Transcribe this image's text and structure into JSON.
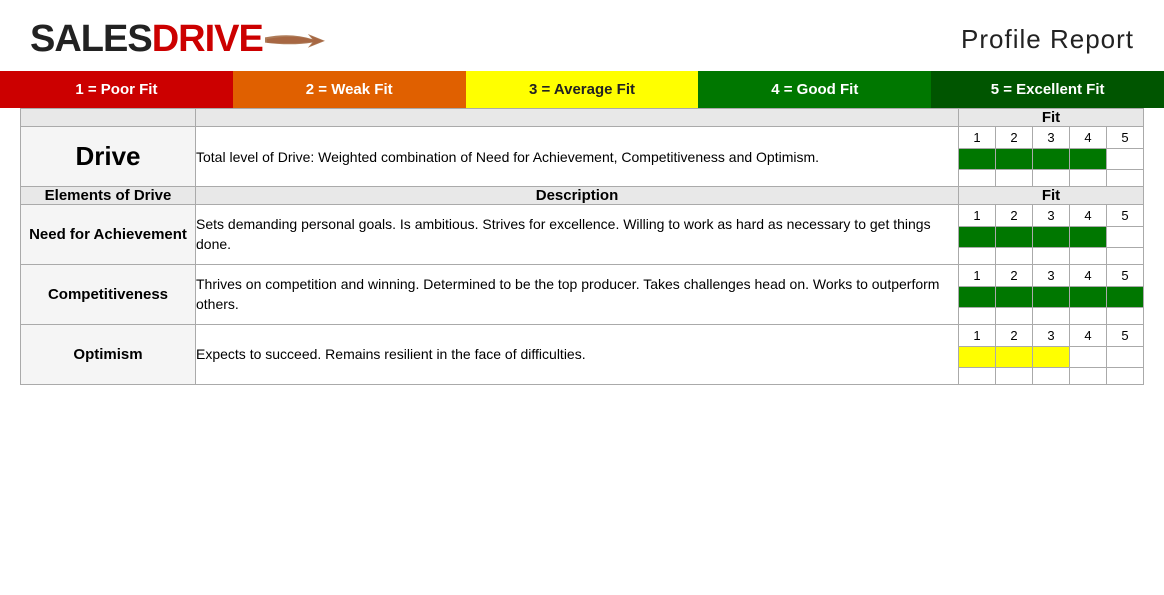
{
  "header": {
    "logo_sales": "SALES",
    "logo_drive": "DRIVE",
    "report_title": "Profile  Report"
  },
  "legend": [
    {
      "label": "1 = Poor Fit",
      "class": "legend-1"
    },
    {
      "label": "2 = Weak Fit",
      "class": "legend-2"
    },
    {
      "label": "3 = Average Fit",
      "class": "legend-3"
    },
    {
      "label": "4 = Good Fit",
      "class": "legend-4"
    },
    {
      "label": "5 = Excellent Fit",
      "class": "legend-5"
    }
  ],
  "table": {
    "fit_header": "Fit",
    "description_header": "Description",
    "drive": {
      "label": "Drive",
      "description": "Total level of Drive: Weighted combination of Need for Achievement, Competitiveness and Optimism.",
      "fit_filled": [
        1,
        2,
        3,
        4
      ],
      "fit_color": "green"
    },
    "elements_header": "Elements of Drive",
    "rows": [
      {
        "label": "Need for Achievement",
        "description": "Sets demanding personal goals. Is ambitious. Strives for excellence. Willing to work as hard as necessary to get things done.",
        "fit_filled": [
          1,
          2,
          3,
          4
        ],
        "fit_color": "green"
      },
      {
        "label": "Competitiveness",
        "description": "Thrives on competition and winning. Determined to be the top producer. Takes challenges head on. Works to outperform others.",
        "fit_filled": [
          1,
          2,
          3,
          4,
          5
        ],
        "fit_color": "green"
      },
      {
        "label": "Optimism",
        "description": "Expects to succeed. Remains resilient in the face of difficulties.",
        "fit_filled": [
          1,
          2,
          3
        ],
        "fit_color": "yellow"
      }
    ]
  }
}
